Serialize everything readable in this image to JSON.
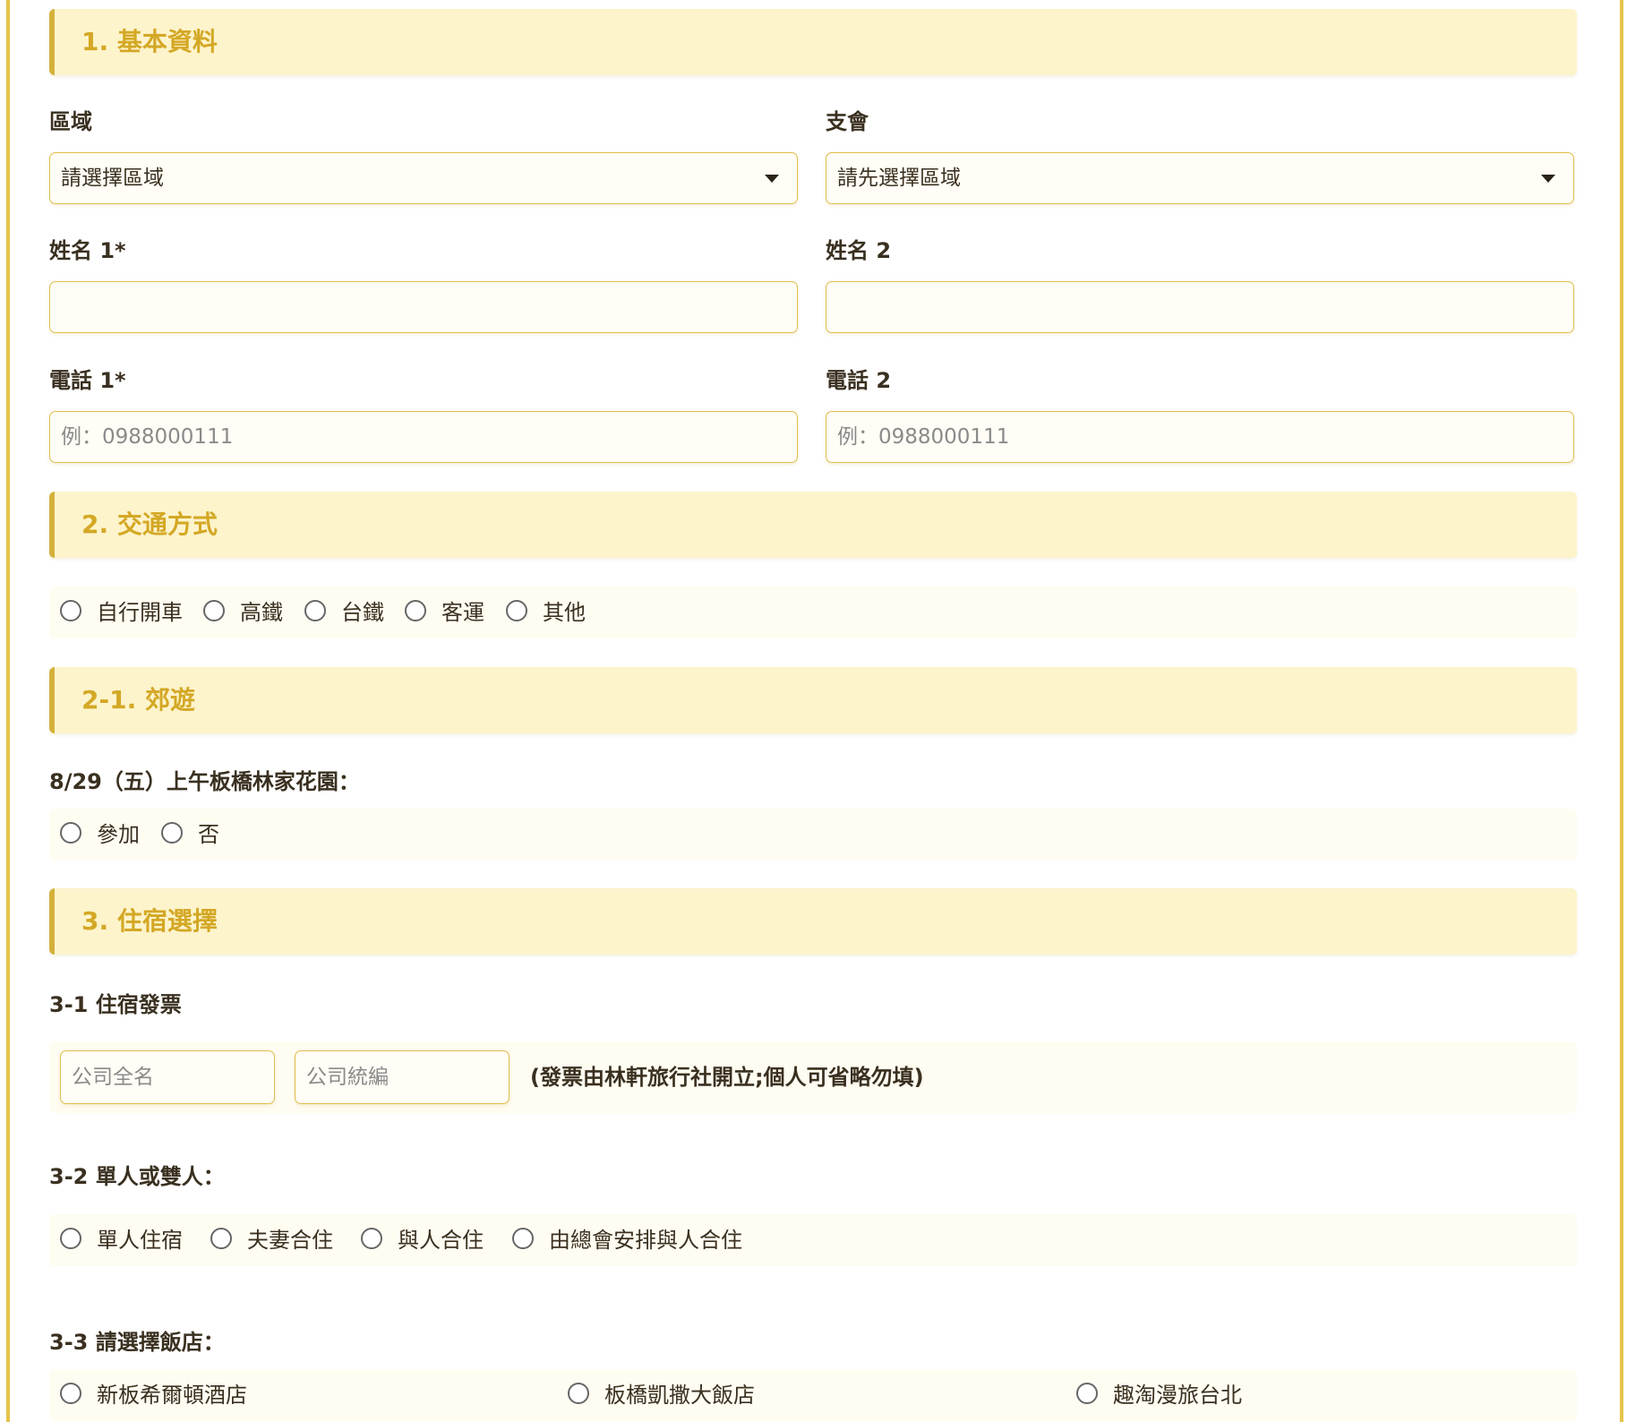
{
  "sections": {
    "basic": "1. 基本資料",
    "transport": "2. 交通方式",
    "excursion": "2-1. 郊遊",
    "lodging": "3. 住宿選擇"
  },
  "basic": {
    "region_label": "區域",
    "region_value": "請選擇區域",
    "chapter_label": "支會",
    "chapter_value": "請先選擇區域",
    "name1_label": "姓名 1*",
    "name2_label": "姓名 2",
    "phone1_label": "電話 1*",
    "phone1_placeholder": "例：0988000111",
    "phone2_label": "電話 2",
    "phone2_placeholder": "例：0988000111"
  },
  "transport": {
    "options": [
      "自行開車",
      "高鐵",
      "台鐵",
      "客運",
      "其他"
    ]
  },
  "excursion": {
    "question": "8/29（五）上午板橋林家花園：",
    "options": [
      "參加",
      "否"
    ]
  },
  "lodging": {
    "invoice_label": "3-1 住宿發票",
    "company_name_placeholder": "公司全名",
    "company_id_placeholder": "公司統編",
    "invoice_note": "(發票由林軒旅行社開立;個人可省略勿填)",
    "room_label": "3-2 單人或雙人：",
    "room_options": [
      "單人住宿",
      "夫妻合住",
      "與人合住",
      "由總會安排與人合住"
    ],
    "hotel_label": "3-3 請選擇飯店：",
    "hotel_options": [
      "新板希爾頓酒店",
      "板橋凱撒大飯店",
      "趣淘漫旅台北"
    ]
  }
}
